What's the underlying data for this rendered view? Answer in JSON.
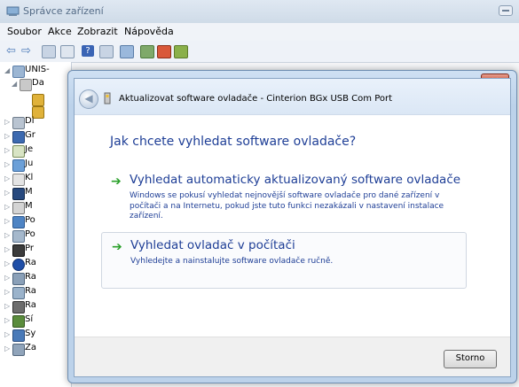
{
  "window": {
    "title": "Správce zařízení"
  },
  "menu": {
    "items": [
      "Soubor",
      "Akce",
      "Zobrazit",
      "Nápověda"
    ]
  },
  "tree": {
    "root": "UNIS-",
    "items": [
      "Da",
      "",
      "",
      "Di",
      "Gr",
      "Je",
      "Ju",
      "Kl",
      "M",
      "M",
      "Po",
      "Po",
      "Pr",
      "Ra",
      "Ra",
      "Ra",
      "Ra",
      "Sí",
      "Sy",
      "Za"
    ]
  },
  "dialog": {
    "header": "Aktualizovat software ovladače - Cinterion BGx USB Com Port",
    "question": "Jak chcete vyhledat software ovladače?",
    "option1": {
      "title": "Vyhledat automaticky aktualizovaný software ovladače",
      "description": "Windows se pokusí vyhledat nejnovější software ovladače pro dané zařízení v počítači a na Internetu, pokud jste tuto funkci nezakázali v nastavení instalace zařízení."
    },
    "option2": {
      "title": "Vyhledat ovladač v počítači",
      "description": "Vyhledejte a nainstalujte software ovladače ručně."
    },
    "cancel_label": "Storno",
    "close_glyph": "✕"
  },
  "colors": {
    "link_blue": "#1e3e96",
    "arrow_green": "#2aa02a"
  }
}
